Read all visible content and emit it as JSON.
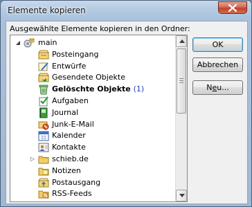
{
  "dialog": {
    "title": "Elemente kopieren",
    "label": "Ausgewählte Elemente kopieren in den Ordner:",
    "buttons": {
      "ok": "OK",
      "cancel": "Abbrechen",
      "new_before": "N",
      "new_mnemonic": "e",
      "new_after": "u..."
    }
  },
  "tree": {
    "root": {
      "label": "main",
      "expanded": true,
      "icon": "mailbox-icon"
    },
    "items": [
      {
        "label": "Posteingang",
        "icon": "inbox-icon",
        "bold": false,
        "count": ""
      },
      {
        "label": "Entwürfe",
        "icon": "drafts-icon",
        "bold": false,
        "count": ""
      },
      {
        "label": "Gesendete Objekte",
        "icon": "sent-items-icon",
        "bold": false,
        "count": ""
      },
      {
        "label": "Gelöschte Objekte",
        "icon": "deleted-items-icon",
        "bold": true,
        "count": "(1)"
      },
      {
        "label": "Aufgaben",
        "icon": "tasks-icon",
        "bold": false,
        "count": ""
      },
      {
        "label": "Journal",
        "icon": "journal-icon",
        "bold": false,
        "count": ""
      },
      {
        "label": "Junk-E-Mail",
        "icon": "junk-mail-icon",
        "bold": false,
        "count": ""
      },
      {
        "label": "Kalender",
        "icon": "calendar-icon",
        "bold": false,
        "count": ""
      },
      {
        "label": "Kontakte",
        "icon": "contacts-icon",
        "bold": false,
        "count": ""
      },
      {
        "label": "schieb.de",
        "icon": "folder-icon",
        "bold": false,
        "count": "",
        "collapsed": true
      },
      {
        "label": "Notizen",
        "icon": "notes-icon",
        "bold": false,
        "count": ""
      },
      {
        "label": "Postausgang",
        "icon": "outbox-icon",
        "bold": false,
        "count": ""
      },
      {
        "label": "RSS-Feeds",
        "icon": "rss-feeds-icon",
        "bold": false,
        "count": ""
      }
    ]
  }
}
